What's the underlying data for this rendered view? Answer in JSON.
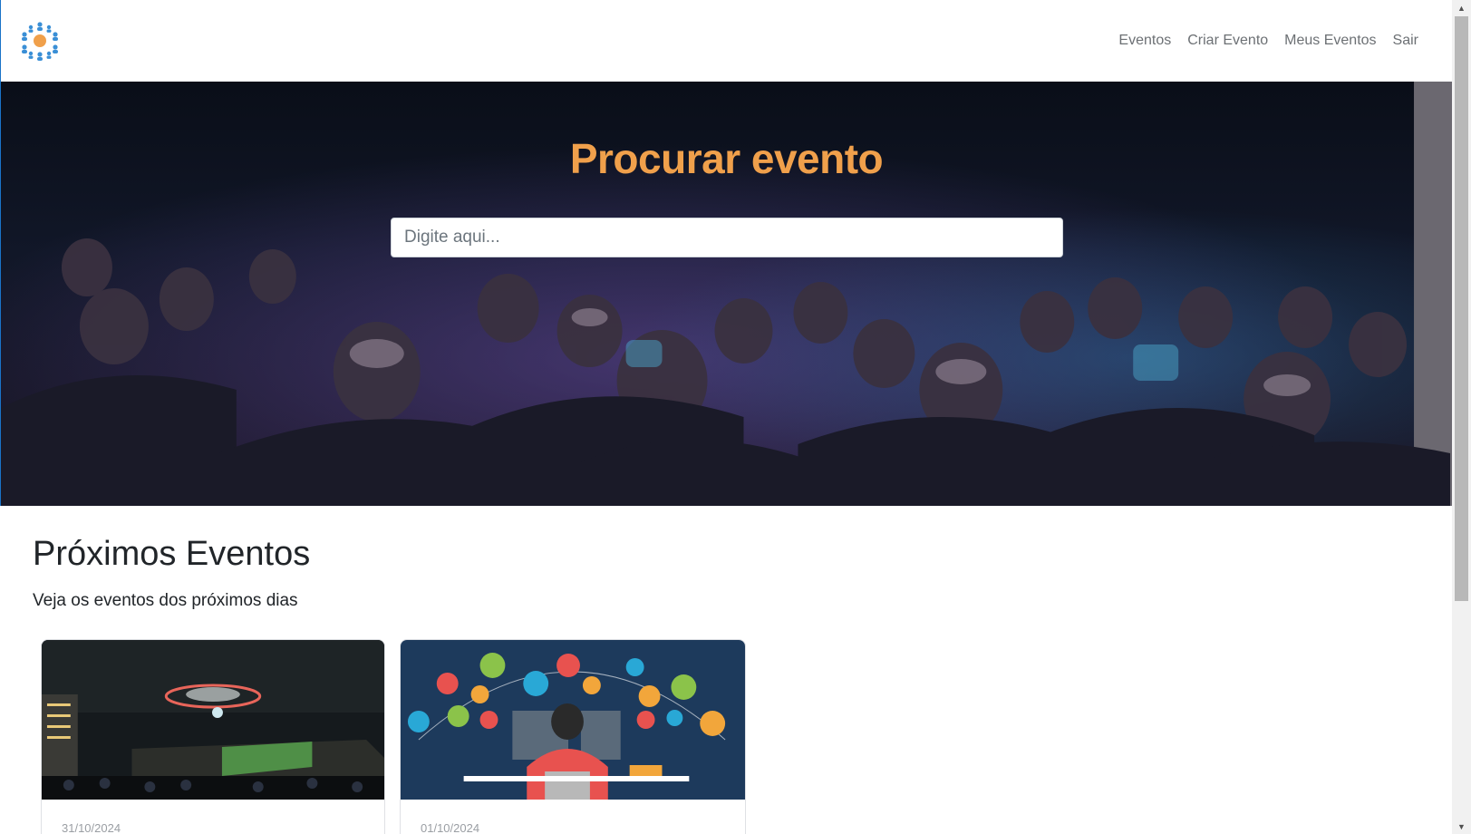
{
  "navbar": {
    "logo": "network-people-logo",
    "links": [
      "Eventos",
      "Criar Evento",
      "Meus Eventos",
      "Sair"
    ]
  },
  "hero": {
    "title": "Procurar evento",
    "search_placeholder": "Digite aqui...",
    "title_color": "#f0a04b"
  },
  "section": {
    "title": "Próximos Eventos",
    "subtitle": "Veja os eventos dos próximos dias"
  },
  "events": [
    {
      "date": "31/10/2024",
      "image": "night-building-ufo-photo"
    },
    {
      "date": "01/10/2024",
      "image": "programmer-languages-illustration"
    }
  ],
  "colors": {
    "accent_orange": "#f0a04b",
    "logo_blue": "#3a8fd6",
    "nav_text": "#6c7074"
  }
}
